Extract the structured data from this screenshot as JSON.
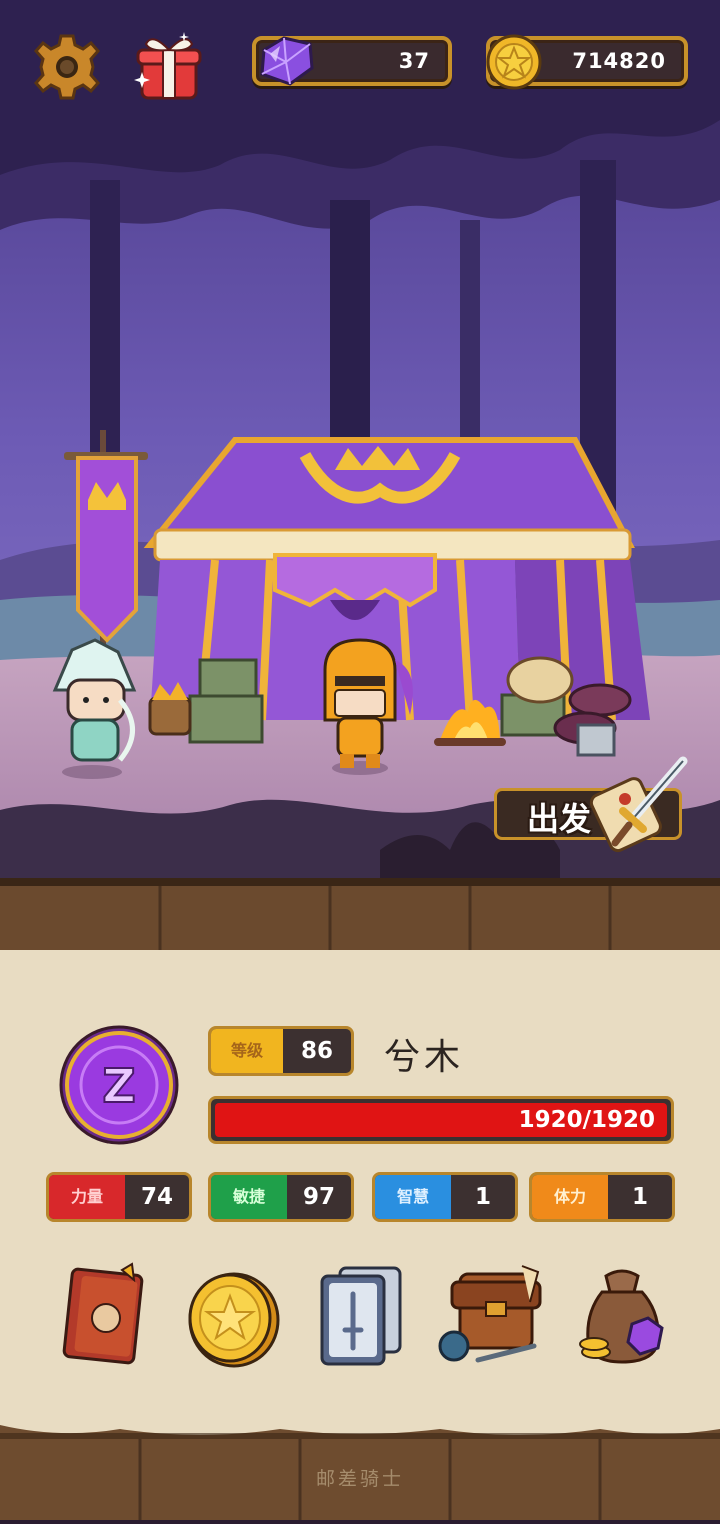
{
  "resources": {
    "gems": "37",
    "gold": "714820"
  },
  "actions": {
    "depart_label": "出发"
  },
  "hero": {
    "level_label": "等级",
    "level": "86",
    "name": "兮木",
    "hp_text": "1920/1920",
    "hp_fraction": 1.0,
    "emblem_letter": "Z"
  },
  "stats": [
    {
      "label": "力量",
      "value": "74",
      "color": "#d8282b",
      "label_color": "#ffd0d0"
    },
    {
      "label": "敏捷",
      "value": "97",
      "color": "#1fa04a",
      "label_color": "#d6ffd8"
    },
    {
      "label": "智慧",
      "value": "1",
      "color": "#2a8fe0",
      "label_color": "#dff0ff"
    },
    {
      "label": "体力",
      "value": "1",
      "color": "#f08a1a",
      "label_color": "#fff0d0"
    }
  ],
  "menu": [
    {
      "name": "hero-book-icon"
    },
    {
      "name": "gold-coin-icon"
    },
    {
      "name": "skill-cards-icon"
    },
    {
      "name": "equipment-backpack-icon"
    },
    {
      "name": "treasure-bag-icon"
    }
  ],
  "footer": {
    "title": "邮差骑士"
  },
  "colors": {
    "gold_border": "#c8922a",
    "tent_purple": "#8a4fd0",
    "parchment": "#e8dcc2"
  }
}
